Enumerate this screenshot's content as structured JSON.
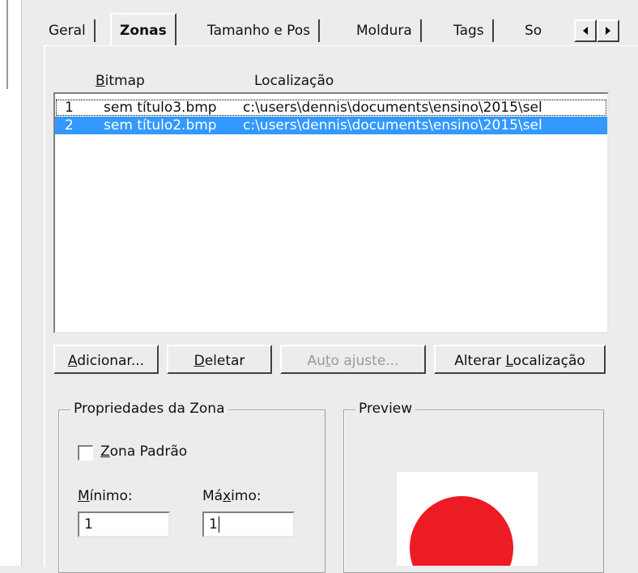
{
  "tabs": [
    {
      "label": "Geral",
      "selected": false
    },
    {
      "label": "Zonas",
      "selected": true
    },
    {
      "label": "Tamanho e Pos",
      "selected": false
    },
    {
      "label": "Moldura",
      "selected": false
    },
    {
      "label": "Tags",
      "selected": false
    },
    {
      "label": "So",
      "selected": false
    }
  ],
  "tab_scroll": {
    "left_icon": "chevron-left-icon",
    "right_icon": "chevron-right-icon"
  },
  "list": {
    "columns": {
      "bitmap_label_prefix": "B",
      "bitmap_label_rest": "itmap",
      "location_label": "Localização"
    },
    "rows": [
      {
        "num": "1",
        "bitmap": "sem título3.bmp",
        "location": "c:\\users\\dennis\\documents\\ensino\\2015\\sel",
        "selected": false
      },
      {
        "num": "2",
        "bitmap": "sem título2.bmp",
        "location": "c:\\users\\dennis\\documents\\ensino\\2015\\sel",
        "selected": true
      }
    ]
  },
  "buttons": {
    "add": {
      "underlined": "A",
      "rest": "dicionar..."
    },
    "delete": {
      "underlined": "D",
      "rest": "eletar"
    },
    "auto": {
      "before": "Au",
      "underlined": "t",
      "rest": "o ajuste..."
    },
    "change_location": {
      "before": "Alterar ",
      "underlined": "L",
      "rest": "ocalização"
    }
  },
  "zone_properties": {
    "title": "Propriedades da Zona",
    "default_zone": {
      "underlined": "Z",
      "rest": "ona Padrão",
      "checked": false
    },
    "min": {
      "underlined": "M",
      "rest": "ínimo:",
      "value": "1"
    },
    "max": {
      "before": "Má",
      "underlined": "x",
      "rest": "imo:",
      "value": "1"
    }
  },
  "preview": {
    "title": "Preview",
    "shape_color": "#ed1c24"
  },
  "colors": {
    "selection": "#3399ff",
    "background": "#ececec"
  }
}
